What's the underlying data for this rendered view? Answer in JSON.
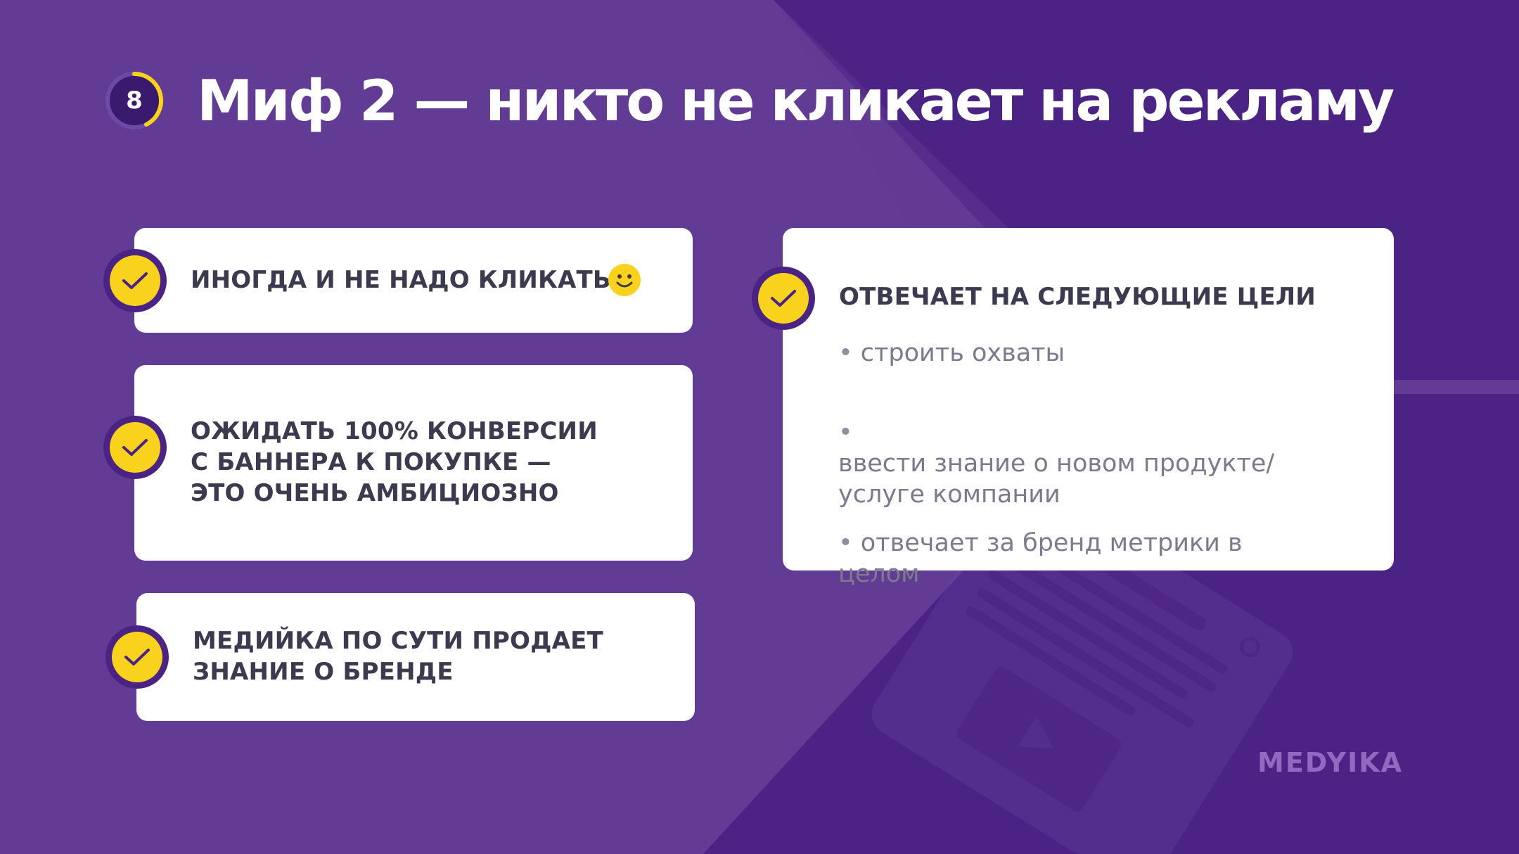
{
  "header": {
    "page_number": "8",
    "title": "Миф 2 — никто не кликает на рекламу"
  },
  "cards": {
    "card1": {
      "text": "ИНОГДА И НЕ НАДО КЛИКАТЬ"
    },
    "card2": {
      "text": "ОЖИДАТЬ 100% КОНВЕРСИИ\nС БАННЕРА К ПОКУПКЕ —\nЭТО ОЧЕНЬ АМБИЦИОЗНО"
    },
    "card3": {
      "text": "МЕДИЙКА ПО СУТИ ПРОДАЕТ\nЗНАНИЕ О БРЕНДЕ"
    },
    "goals": {
      "heading": "ОТВЕЧАЕТ НА СЛЕДУЮЩИЕ ЦЕЛИ",
      "items": [
        "строить охваты",
        "ввести знание о новом продукте/\nуслуге компании",
        "отвечает за бренд метрики в целом"
      ]
    }
  },
  "brand": {
    "logo": "MEDYIKA"
  },
  "icons": {
    "check": "check-icon",
    "smiley": "smiley-icon",
    "watermark": "device-illustration"
  },
  "colors": {
    "background_dark": "#4a2384",
    "background_light": "#623c94",
    "accent_yellow": "#f8d21c",
    "card_bg": "#ffffff",
    "card_text": "#3b3a4e",
    "bullet_text": "#7c7a8c"
  }
}
